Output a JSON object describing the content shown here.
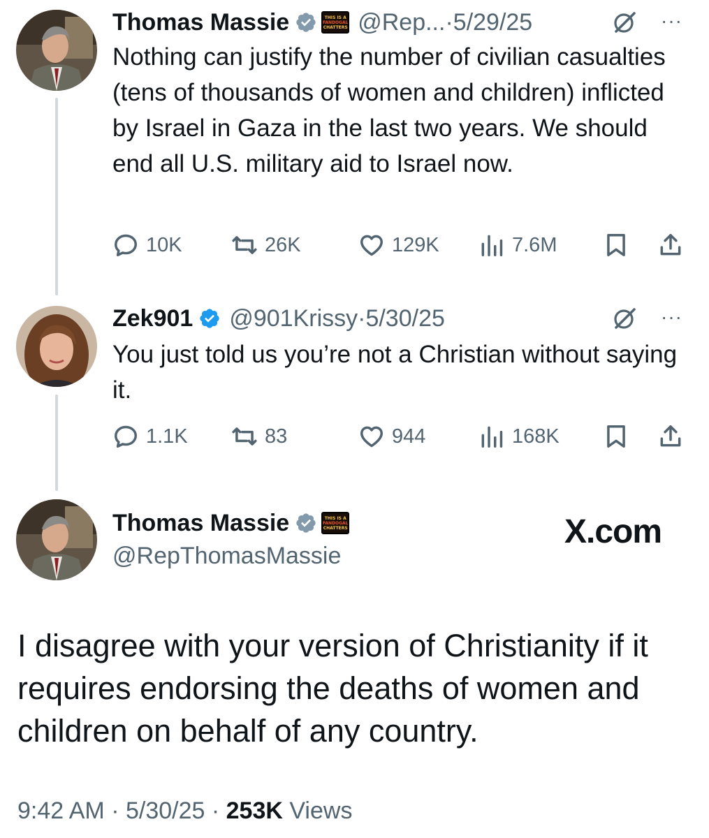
{
  "tweet1": {
    "name": "Thomas Massie",
    "handle": "@Rep...",
    "sep": " · ",
    "date": "5/29/25",
    "more": "···",
    "text": "Nothing can justify the number of civilian casualties (tens of thousands of women and children)  inflicted by Israel in Gaza in the last two years. We should end all U.S. military aid to Israel now.",
    "replies": "10K",
    "reposts": "26K",
    "likes": "129K",
    "views": "7.6M"
  },
  "tweet2": {
    "name": "Zek901",
    "handle": "@901Krissy",
    "sep": " · ",
    "date": "5/30/25",
    "more": "···",
    "text": "You just told us you’re not a Christian without saying it.",
    "replies": "1.1K",
    "reposts": "83",
    "likes": "944",
    "views": "168K"
  },
  "main": {
    "name": "Thomas Massie",
    "handle": "@RepThomasMassie",
    "watermark": "X.com",
    "text": "I disagree with your version of Christianity if it requires endorsing the deaths of women and children on behalf of any country.",
    "time": "9:42 AM",
    "sep": " · ",
    "date": "5/30/25",
    "views_count": "253K",
    "views_label": " Views"
  },
  "badges": {
    "affiliate_line1": "THIS IS A",
    "affiliate_line2": "FANDOGAL",
    "affiliate_line3": "CHATTERS"
  },
  "colors": {
    "verified": "#1d9bf0",
    "verified_gov": "#829aab",
    "muted": "#536471",
    "thread_line": "#cfd9de"
  },
  "icons": {
    "reply": "reply-icon",
    "repost": "repost-icon",
    "like": "like-icon",
    "views": "views-icon",
    "bookmark": "bookmark-icon",
    "share": "share-icon",
    "grok": "grok-icon"
  }
}
